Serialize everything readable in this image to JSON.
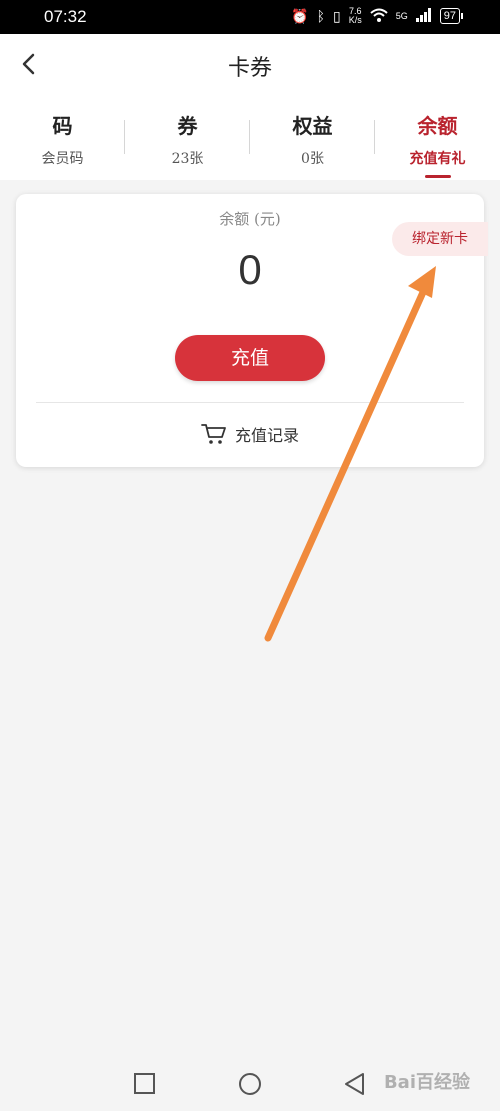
{
  "status_bar": {
    "time": "07:32",
    "net_speed_value": "7.6",
    "net_speed_unit": "K/s",
    "network": "5G",
    "battery": "97"
  },
  "header": {
    "title": "卡券"
  },
  "tabs": [
    {
      "label": "码",
      "sub": "会员码",
      "active": false
    },
    {
      "label": "券",
      "sub": "23张",
      "active": false
    },
    {
      "label": "权益",
      "sub": "0张",
      "active": false
    },
    {
      "label": "余额",
      "sub": "充值有礼",
      "active": true
    }
  ],
  "balance_card": {
    "label": "余额 (元)",
    "value": "0",
    "bind_card_label": "绑定新卡",
    "recharge_label": "充值",
    "recharge_record_label": "充值记录"
  },
  "colors": {
    "accent": "#b9232e",
    "button": "#d7333b",
    "arrow": "#f08a3c"
  },
  "watermark": "Bai百经验"
}
